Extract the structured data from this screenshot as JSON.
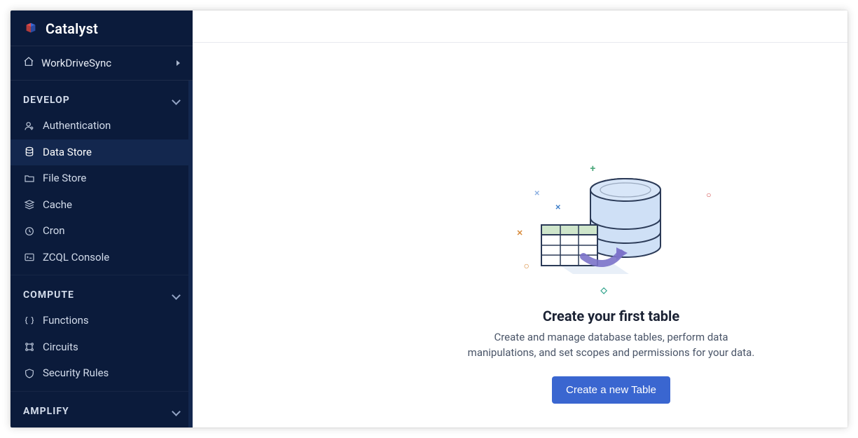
{
  "brand": {
    "name": "Catalyst"
  },
  "project": {
    "name": "WorkDriveSync"
  },
  "sections": {
    "develop": {
      "header": "DEVELOP",
      "items": [
        {
          "label": "Authentication"
        },
        {
          "label": "Data Store"
        },
        {
          "label": "File Store"
        },
        {
          "label": "Cache"
        },
        {
          "label": "Cron"
        },
        {
          "label": "ZCQL Console"
        }
      ]
    },
    "compute": {
      "header": "COMPUTE",
      "items": [
        {
          "label": "Functions"
        },
        {
          "label": "Circuits"
        },
        {
          "label": "Security Rules"
        }
      ]
    },
    "amplify": {
      "header": "AMPLIFY"
    }
  },
  "empty_state": {
    "title": "Create your first table",
    "description": "Create and manage database tables, perform data manipulations, and set scopes and permissions for your data.",
    "cta": "Create a new Table"
  },
  "colors": {
    "sidebar_bg": "#0b1b3b",
    "active_bg": "#13274e",
    "primary_button": "#3a66d0"
  }
}
